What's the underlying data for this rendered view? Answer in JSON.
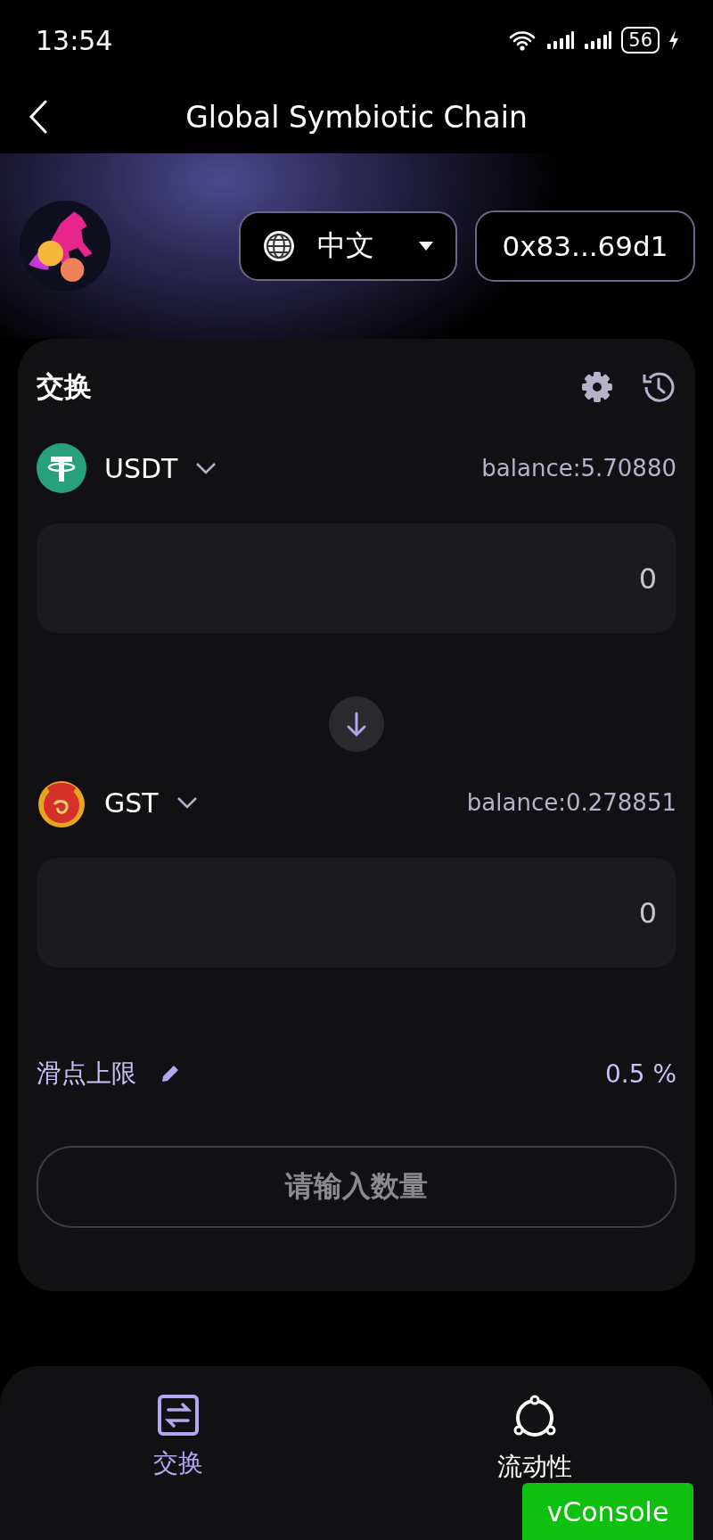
{
  "status_bar": {
    "time": "13:54",
    "battery": "56"
  },
  "header": {
    "title": "Global Symbiotic Chain"
  },
  "top_bar": {
    "language": "中文",
    "address": "0x83...69d1"
  },
  "swap": {
    "title": "交换",
    "tokens": [
      {
        "symbol": "USDT",
        "balance": "balance:5.70880",
        "placeholder": "0",
        "kind": "usdt"
      },
      {
        "symbol": "GST",
        "balance": "balance:0.278851",
        "placeholder": "0",
        "kind": "gst"
      }
    ],
    "slippage": {
      "label": "滑点上限",
      "value": "0.5 %"
    },
    "submit": {
      "label": "请输入数量",
      "disabled": true
    }
  },
  "nav": [
    {
      "label": "交换",
      "selected": true,
      "kind": "swap"
    },
    {
      "label": "流动性",
      "selected": false,
      "kind": "liquidity"
    }
  ],
  "vconsole": "vConsole"
}
